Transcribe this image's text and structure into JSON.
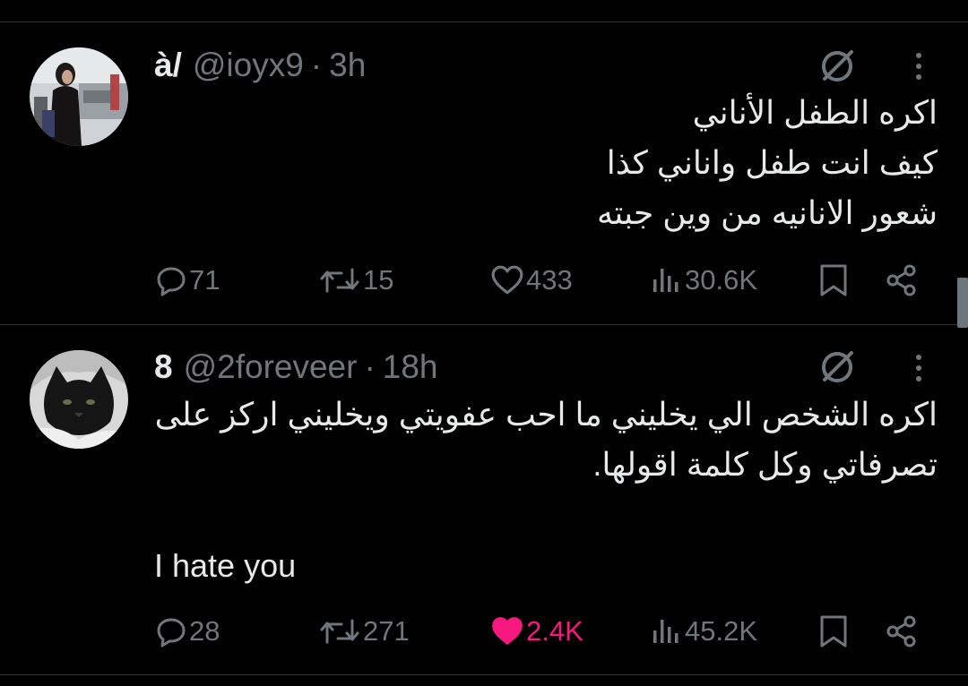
{
  "tweets": [
    {
      "name": "à/",
      "handle": "@ioyx9",
      "separator": "·",
      "time": "3h",
      "lines": [
        "اكره الطفل الأناني",
        "كيف انت طفل واناني كذا",
        "شعور الانانيه من وين جبته"
      ],
      "english": "",
      "replies": "71",
      "reposts": "15",
      "likes": "433",
      "views": "30.6K",
      "liked": false
    },
    {
      "name": "8",
      "handle": "@2foreveer",
      "separator": "·",
      "time": "18h",
      "lines": [
        "اكره الشخص الي يخليني ما احب عفويتي ويخليني اركز على",
        "تصرفاتي وكل كلمة اقولها."
      ],
      "english": "I hate you",
      "replies": "28",
      "reposts": "271",
      "likes": "2.4K",
      "views": "45.2K",
      "liked": true
    }
  ],
  "colors": {
    "background": "#000000",
    "text": "#e7e9ea",
    "muted": "#71767b",
    "like_active": "#f91880",
    "divider": "#2f3336"
  }
}
